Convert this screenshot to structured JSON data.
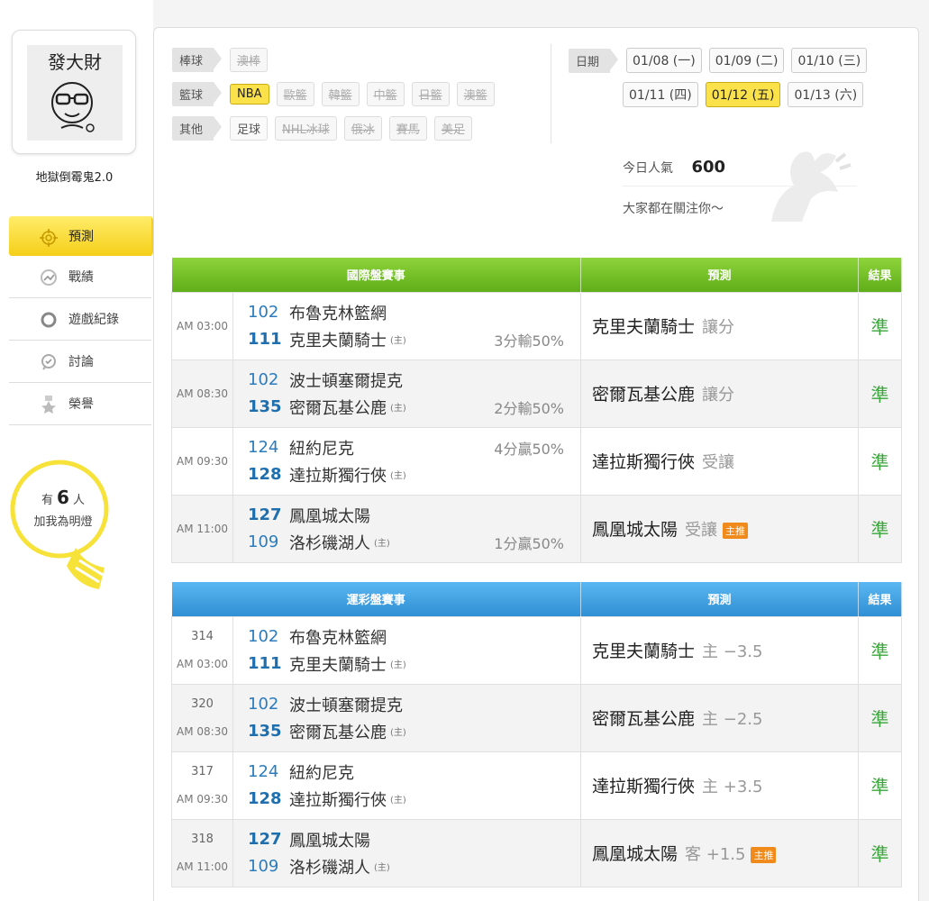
{
  "user": {
    "avatar_text": "發大財",
    "name": "地獄倒霉鬼2.0"
  },
  "nav": [
    {
      "label": "預測",
      "icon": "target-icon",
      "active": true
    },
    {
      "label": "戰績",
      "icon": "chart-icon"
    },
    {
      "label": "遊戲紀錄",
      "icon": "circle-icon"
    },
    {
      "label": "討論",
      "icon": "chat-icon"
    },
    {
      "label": "榮譽",
      "icon": "medal-icon"
    }
  ],
  "lamp": {
    "prefix": "有",
    "count": "6",
    "suffix": "人",
    "line2": "加我為明燈"
  },
  "filters": {
    "baseball": {
      "label": "棒球",
      "items": [
        "澳棒"
      ]
    },
    "basketball": {
      "label": "籃球",
      "items": [
        "NBA",
        "歐籃",
        "韓籃",
        "中籃",
        "日籃",
        "澳籃"
      ]
    },
    "other": {
      "label": "其他",
      "items": [
        "足球",
        "NHL冰球",
        "俄冰",
        "賽馬",
        "美足"
      ]
    }
  },
  "dates": {
    "label": "日期",
    "items": [
      "01/08 (一)",
      "01/09 (二)",
      "01/10 (三)",
      "01/11 (四)",
      "01/12 (五)",
      "01/13 (六)"
    ],
    "selected": "01/12 (五)"
  },
  "popularity": {
    "label": "今日人氣",
    "value": "600",
    "sub": "大家都在關注你～"
  },
  "intl_table": {
    "headers": [
      "國際盤賽事",
      "預測",
      "結果"
    ],
    "rows": [
      {
        "time": "AM 03:00",
        "t1_no": "102",
        "t1": "布魯克林籃網",
        "t1_hc": "",
        "t2_no": "111",
        "t2": "克里夫蘭騎士",
        "t2_hc": "3分輸50%",
        "home": "(主)",
        "pick": "克里夫蘭騎士",
        "ptype": "讓分",
        "badge": "",
        "result": "準"
      },
      {
        "time": "AM 08:30",
        "t1_no": "102",
        "t1": "波士頓塞爾提克",
        "t1_hc": "",
        "t2_no": "135",
        "t2": "密爾瓦基公鹿",
        "t2_hc": "2分輸50%",
        "home": "(主)",
        "pick": "密爾瓦基公鹿",
        "ptype": "讓分",
        "badge": "",
        "result": "準"
      },
      {
        "time": "AM 09:30",
        "t1_no": "124",
        "t1": "紐約尼克",
        "t1_hc": "4分贏50%",
        "t2_no": "128",
        "t2": "達拉斯獨行俠",
        "t2_hc": "",
        "home": "(主)",
        "pick": "達拉斯獨行俠",
        "ptype": "受讓",
        "badge": "",
        "result": "準"
      },
      {
        "time": "AM 11:00",
        "t1_no": "127",
        "t1": "鳳凰城太陽",
        "t1_hc": "",
        "t2_no": "109",
        "t2": "洛杉磯湖人",
        "t2_hc": "1分贏50%",
        "home": "(主)",
        "pick": "鳳凰城太陽",
        "ptype": "受讓",
        "badge": "主推",
        "result": "準"
      }
    ]
  },
  "sport_table": {
    "headers": [
      "運彩盤賽事",
      "預測",
      "結果"
    ],
    "rows": [
      {
        "code": "314",
        "time": "AM 03:00",
        "t1_no": "102",
        "t1": "布魯克林籃網",
        "t2_no": "111",
        "t2": "克里夫蘭騎士",
        "home": "(主)",
        "pick": "克里夫蘭騎士",
        "ptype": "主 −3.5",
        "badge": "",
        "result": "準"
      },
      {
        "code": "320",
        "time": "AM 08:30",
        "t1_no": "102",
        "t1": "波士頓塞爾提克",
        "t2_no": "135",
        "t2": "密爾瓦基公鹿",
        "home": "(主)",
        "pick": "密爾瓦基公鹿",
        "ptype": "主 −2.5",
        "badge": "",
        "result": "準"
      },
      {
        "code": "317",
        "time": "AM 09:30",
        "t1_no": "124",
        "t1": "紐約尼克",
        "t2_no": "128",
        "t2": "達拉斯獨行俠",
        "home": "(主)",
        "pick": "達拉斯獨行俠",
        "ptype": "主 +3.5",
        "badge": "",
        "result": "準"
      },
      {
        "code": "318",
        "time": "AM 11:00",
        "t1_no": "127",
        "t1": "鳳凰城太陽",
        "t2_no": "109",
        "t2": "洛杉磯湖人",
        "home": "(主)",
        "pick": "鳳凰城太陽",
        "ptype": "客 +1.5",
        "badge": "主推",
        "result": "準"
      }
    ]
  }
}
